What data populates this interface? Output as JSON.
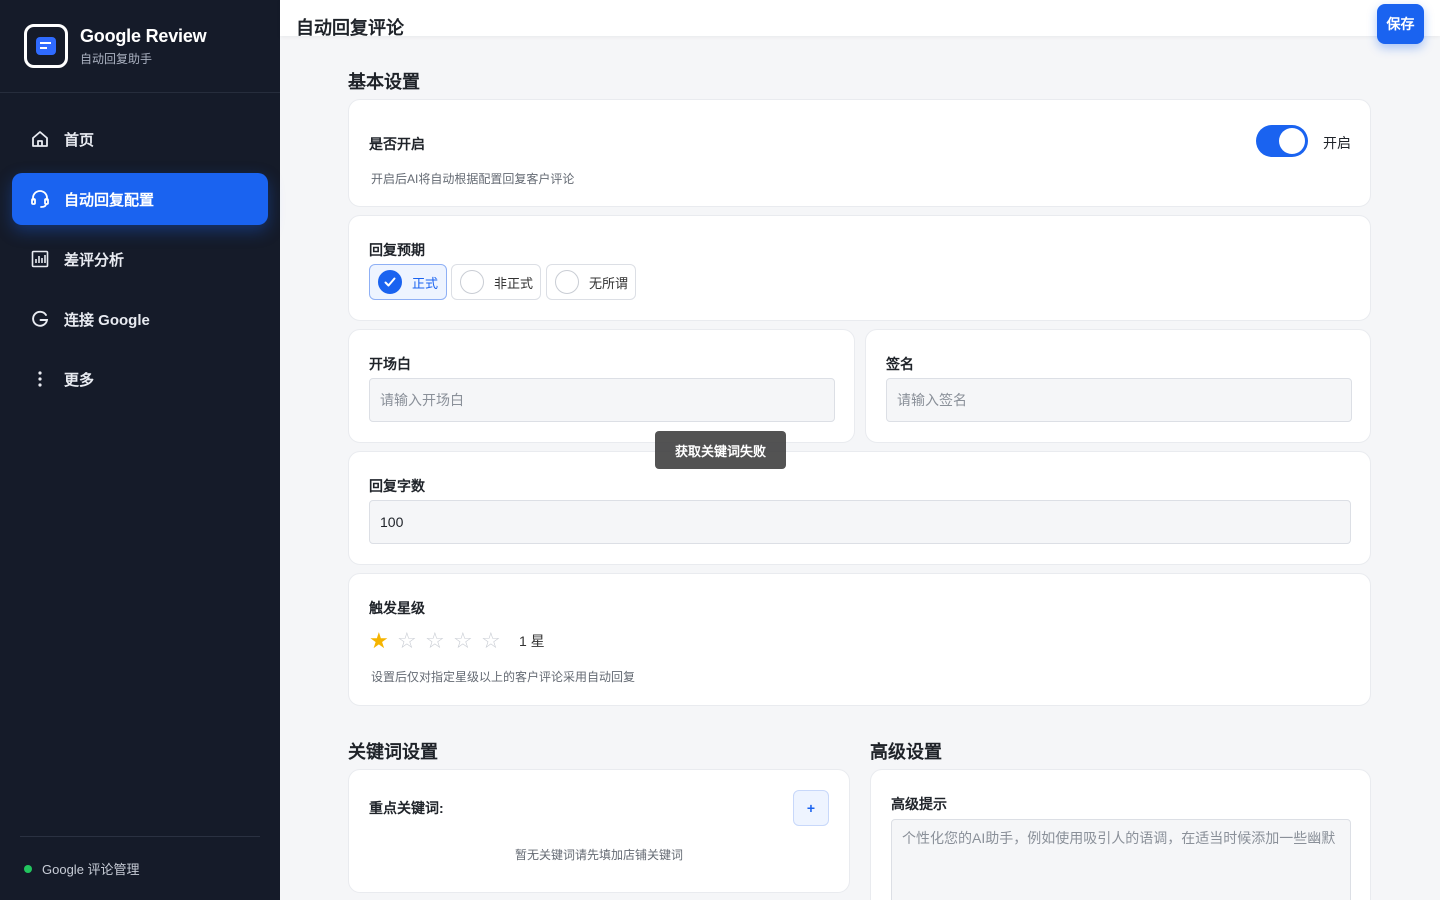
{
  "brand": {
    "title": "Google Review",
    "subtitle": "自动回复助手"
  },
  "nav": {
    "items": [
      {
        "label": "首页",
        "icon": "home-icon",
        "active": false
      },
      {
        "label": "自动回复配置",
        "icon": "headset-icon",
        "active": true
      },
      {
        "label": "差评分析",
        "icon": "chart-icon",
        "active": false
      },
      {
        "label": "连接 Google",
        "icon": "google-g-icon",
        "active": false
      },
      {
        "label": "更多",
        "icon": "more-vertical-icon",
        "active": false
      }
    ]
  },
  "footer": {
    "status_text": "Google 评论管理",
    "status_color": "#22c55e"
  },
  "header": {
    "title": "自动回复评论",
    "save_label": "保存"
  },
  "basic": {
    "title": "基本设置",
    "enable": {
      "label": "是否开启",
      "state_label": "开启",
      "on": true,
      "hint": "开启后AI将自动根据配置回复客户评论"
    },
    "tone": {
      "label": "回复预期",
      "options": [
        {
          "label": "正式",
          "checked": true
        },
        {
          "label": "非正式",
          "checked": false
        },
        {
          "label": "无所谓",
          "checked": false
        }
      ]
    },
    "opening": {
      "label": "开场白",
      "placeholder": "请输入开场白"
    },
    "signature": {
      "label": "签名",
      "placeholder": "请输入签名"
    },
    "word_count": {
      "label": "回复字数",
      "value": "100"
    },
    "trigger": {
      "label": "触发星级",
      "rating": 1,
      "max": 5,
      "rating_text": "1 星",
      "hint": "设置后仅对指定星级以上的客户评论采用自动回复"
    }
  },
  "toast": {
    "text": "获取关键词失败"
  },
  "keywords": {
    "title": "关键词设置",
    "label": "重点关键词:",
    "add_label": "+",
    "empty_text": "暂无关键词请先填加店铺关键词"
  },
  "advanced": {
    "title": "高级设置",
    "label": "高级提示",
    "placeholder": "个性化您的AI助手，例如使用吸引人的语调，在适当时候添加一些幽默"
  },
  "colors": {
    "accent": "#1a63f0",
    "sidebar_bg": "#151b29",
    "star": "#f5b400"
  }
}
